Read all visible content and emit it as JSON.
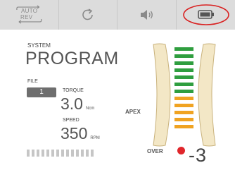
{
  "topbar": {
    "buttons": [
      {
        "name": "auto-reverse-button",
        "icon": "auto-reverse-icon",
        "line1": "AUTO",
        "line2": "REV"
      },
      {
        "name": "rotation-button",
        "icon": "rotate-icon"
      },
      {
        "name": "volume-button",
        "icon": "speaker-icon"
      },
      {
        "name": "battery-button",
        "icon": "battery-icon"
      }
    ]
  },
  "program": {
    "system_label": "SYSTEM",
    "title": "PROGRAM"
  },
  "file": {
    "label": "FILE",
    "value": "1"
  },
  "torque": {
    "label": "TORQUE",
    "value": "3.0",
    "unit": "Ncm"
  },
  "speed": {
    "label": "SPEED",
    "value": "350",
    "unit": "RPM"
  },
  "progress": {
    "segments": 14
  },
  "apex": {
    "apex_label": "APEX",
    "over_label": "OVER",
    "readout": "-3",
    "bars": [
      "green",
      "green",
      "green",
      "green",
      "green",
      "green",
      "green",
      "orange",
      "orange",
      "orange",
      "orange",
      "orange"
    ]
  },
  "colors": {
    "green": "#2f9e3f",
    "orange": "#f0a321",
    "red_dot": "#e0262b",
    "highlight_circle": "#d92121",
    "gauge_fill": "#f3e7c6",
    "gauge_stroke": "#c9b27c"
  }
}
